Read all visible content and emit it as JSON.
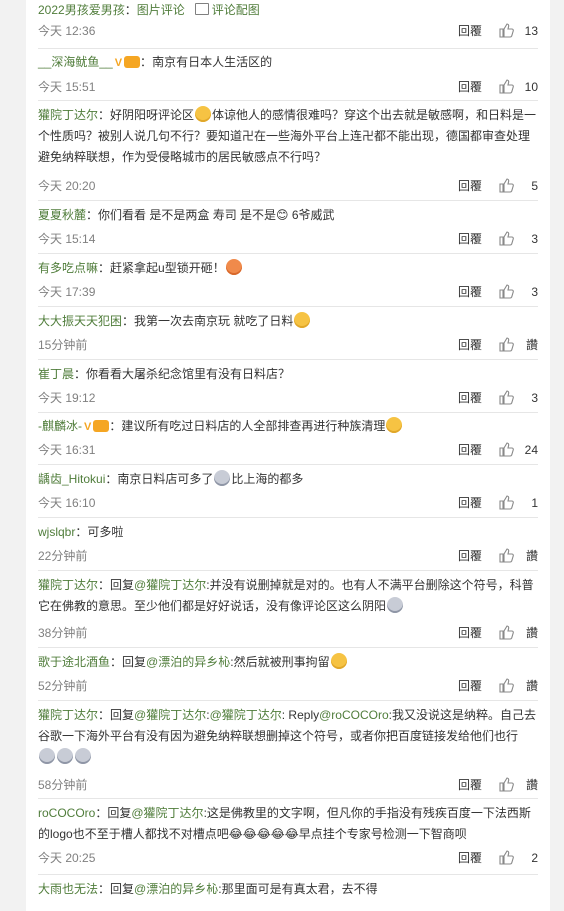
{
  "comments": [
    {
      "user": "2022男孩爱男孩",
      "sep": "：",
      "body": "图片评论",
      "extra": "评论配图",
      "time": "今天 12:36",
      "reply": "回覆",
      "likes": "13"
    },
    {
      "user": "__深海鱿鱼__",
      "sep": "：",
      "body": "南京有日本人生活区的",
      "time": "今天 15:51",
      "reply": "回覆",
      "likes": "10"
    },
    {
      "user": "獾院丁达尔",
      "sep": "：",
      "body1": "好阴阳呀评论区",
      "body2": "体谅他人的感情很难吗？穿这个出去就是敏感啊，和日料是一个性质吗？被别人说几句不行？要知道卍在一些海外平台上连卍都不能出现，德国都审查处理避免纳粹联想，作为受侵略城市的居民敏感点不行吗？",
      "time": "今天 20:20",
      "reply": "回覆",
      "likes": "5"
    },
    {
      "user": "夏夏秋麓",
      "sep": "：",
      "body": "你们看看 是不是两盒 寿司 是不是😊 6爷威武",
      "time": "今天 15:14",
      "reply": "回覆",
      "likes": "3"
    },
    {
      "user": "有多吃点嘛",
      "sep": "：",
      "body": "赶紧拿起u型锁开砸！",
      "time": "今天 17:39",
      "reply": "回覆",
      "likes": "3"
    },
    {
      "user": "大大振天天犯困",
      "sep": "：",
      "body": "我第一次去南京玩 就吃了日料",
      "time": "15分钟前",
      "reply": "回覆",
      "likes": "讚"
    },
    {
      "user": "崔丁晨",
      "sep": "：",
      "body": "你看看大屠杀纪念馆里有没有日料店？",
      "time": "今天 19:12",
      "reply": "回覆",
      "likes": "3"
    },
    {
      "user": "-麒麟冰-",
      "sep": "：",
      "body": "建议所有吃过日料店的人全部排查再进行种族清理",
      "time": "今天 16:31",
      "reply": "回覆",
      "likes": "24"
    },
    {
      "user": "龋齿_Hitokui",
      "sep": "：",
      "body1": "南京日料店可多了",
      "body2": "比上海的都多",
      "time": "今天 16:10",
      "reply": "回覆",
      "likes": "1"
    },
    {
      "user": "wjslqbr",
      "sep": "：",
      "body": "可多啦",
      "time": "22分钟前",
      "reply": "回覆",
      "likes": "讚"
    },
    {
      "user": "獾院丁达尔",
      "sep": "：",
      "pre": "回复",
      "mention": "@獾院丁达尔",
      "body": ":并没有说删掉就是对的。也有人不满平台删除这个符号，科普它在佛教的意思。至少他们都是好好说话，没有像评论区这么阴阳",
      "time": "38分钟前",
      "reply": "回覆",
      "likes": "讚"
    },
    {
      "user": "歌于途北酒鱼",
      "sep": "：",
      "pre": "回复",
      "mention": "@漂泊的异乡杺",
      "body": ":然后就被刑事拘留",
      "time": "52分钟前",
      "reply": "回覆",
      "likes": "讚"
    },
    {
      "user": "獾院丁达尔",
      "sep": "：",
      "pre": "回复",
      "mention": "@獾院丁达尔",
      "mid": ":",
      "mention2": "@獾院丁达尔",
      "mid2": ": Reply",
      "mention3": "@roCOCOro",
      "body": ":我又没说这是纳粹。自己去谷歌一下海外平台有没有因为避免纳粹联想删掉这个符号，或者你把百度链接发给他们也行",
      "time": "58分钟前",
      "reply": "回覆",
      "likes": "讚"
    },
    {
      "user": "roCOCOro",
      "sep": "：",
      "pre": "回复",
      "mention": "@獾院丁达尔",
      "body": ":这是佛教里的文字啊，但凡你的手指没有残疾百度一下法西斯的logo也不至于槽人都找不对槽点吧😂😂😂😂😂早点挂个专家号检测一下智商呗",
      "time": "今天 20:25",
      "reply": "回覆",
      "likes": "2"
    },
    {
      "user": "大雨也无法",
      "sep": "：",
      "pre": "回复",
      "mention": "@漂泊的异乡杺",
      "body": ":那里面可是有真太君，去不得"
    }
  ]
}
